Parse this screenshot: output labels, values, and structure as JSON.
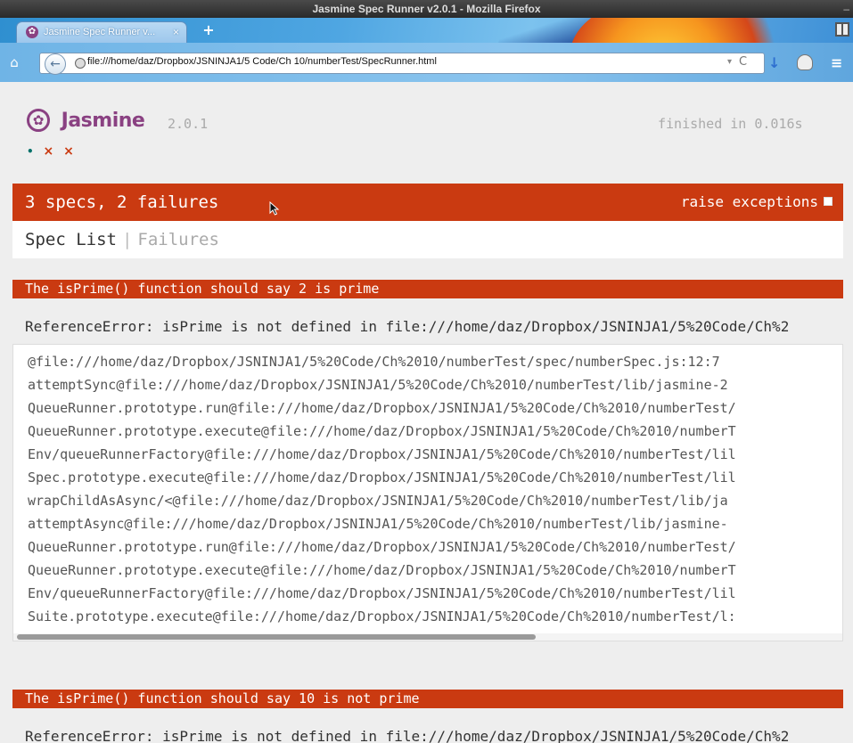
{
  "window": {
    "title": "Jasmine Spec Runner v2.0.1 - Mozilla Firefox",
    "min_glyph": "–"
  },
  "tabs": [
    {
      "label": "Jasmine Spec Runner v...",
      "icon": "jasmine-favicon",
      "close_glyph": "×"
    }
  ],
  "toolbar": {
    "new_tab_glyph": "+",
    "home_glyph": "⌂",
    "back_glyph": "←",
    "url": "file:///home/daz/Dropbox/JSNINJA1/5 Code/Ch 10/numberTest/SpecRunner.html",
    "dropdown_glyph": "▾",
    "reload_glyph": "C",
    "download_glyph": "↓",
    "menu_glyph": "≡"
  },
  "jasmine": {
    "logo_glyph": "✿",
    "logo_text": "Jasmine",
    "version": "2.0.1",
    "duration": "finished in 0.016s",
    "symbols": [
      {
        "glyph": "•",
        "status": "passed"
      },
      {
        "glyph": "×",
        "status": "failed"
      },
      {
        "glyph": "×",
        "status": "failed"
      }
    ],
    "summary": "3 specs, 2 failures",
    "raise_exceptions_label": "raise exceptions",
    "menu": {
      "spec_list": "Spec List",
      "separator": "|",
      "failures": "Failures"
    },
    "failures": [
      {
        "description": "The isPrime() function should say 2 is prime",
        "message": "ReferenceError: isPrime is not defined in file:///home/daz/Dropbox/JSNINJA1/5%20Code/Ch%2",
        "stack": [
          "@file:///home/daz/Dropbox/JSNINJA1/5%20Code/Ch%2010/numberTest/spec/numberSpec.js:12:7",
          "attemptSync@file:///home/daz/Dropbox/JSNINJA1/5%20Code/Ch%2010/numberTest/lib/jasmine-2",
          "QueueRunner.prototype.run@file:///home/daz/Dropbox/JSNINJA1/5%20Code/Ch%2010/numberTest/",
          "QueueRunner.prototype.execute@file:///home/daz/Dropbox/JSNINJA1/5%20Code/Ch%2010/numberT",
          "Env/queueRunnerFactory@file:///home/daz/Dropbox/JSNINJA1/5%20Code/Ch%2010/numberTest/lil",
          "Spec.prototype.execute@file:///home/daz/Dropbox/JSNINJA1/5%20Code/Ch%2010/numberTest/lil",
          "wrapChildAsAsync/<@file:///home/daz/Dropbox/JSNINJA1/5%20Code/Ch%2010/numberTest/lib/ja",
          "attemptAsync@file:///home/daz/Dropbox/JSNINJA1/5%20Code/Ch%2010/numberTest/lib/jasmine-",
          "QueueRunner.prototype.run@file:///home/daz/Dropbox/JSNINJA1/5%20Code/Ch%2010/numberTest/",
          "QueueRunner.prototype.execute@file:///home/daz/Dropbox/JSNINJA1/5%20Code/Ch%2010/numberT",
          "Env/queueRunnerFactory@file:///home/daz/Dropbox/JSNINJA1/5%20Code/Ch%2010/numberTest/lil",
          "Suite.prototype.execute@file:///home/daz/Dropbox/JSNINJA1/5%20Code/Ch%2010/numberTest/l:"
        ]
      },
      {
        "description": "The isPrime() function should say 10 is not prime",
        "message": "ReferenceError: isPrime is not defined in file:///home/daz/Dropbox/JSNINJA1/5%20Code/Ch%2"
      }
    ]
  },
  "colors": {
    "failure_red": "#ca3a11",
    "jasmine_purple": "#8a4182",
    "pass_green": "#007069"
  }
}
